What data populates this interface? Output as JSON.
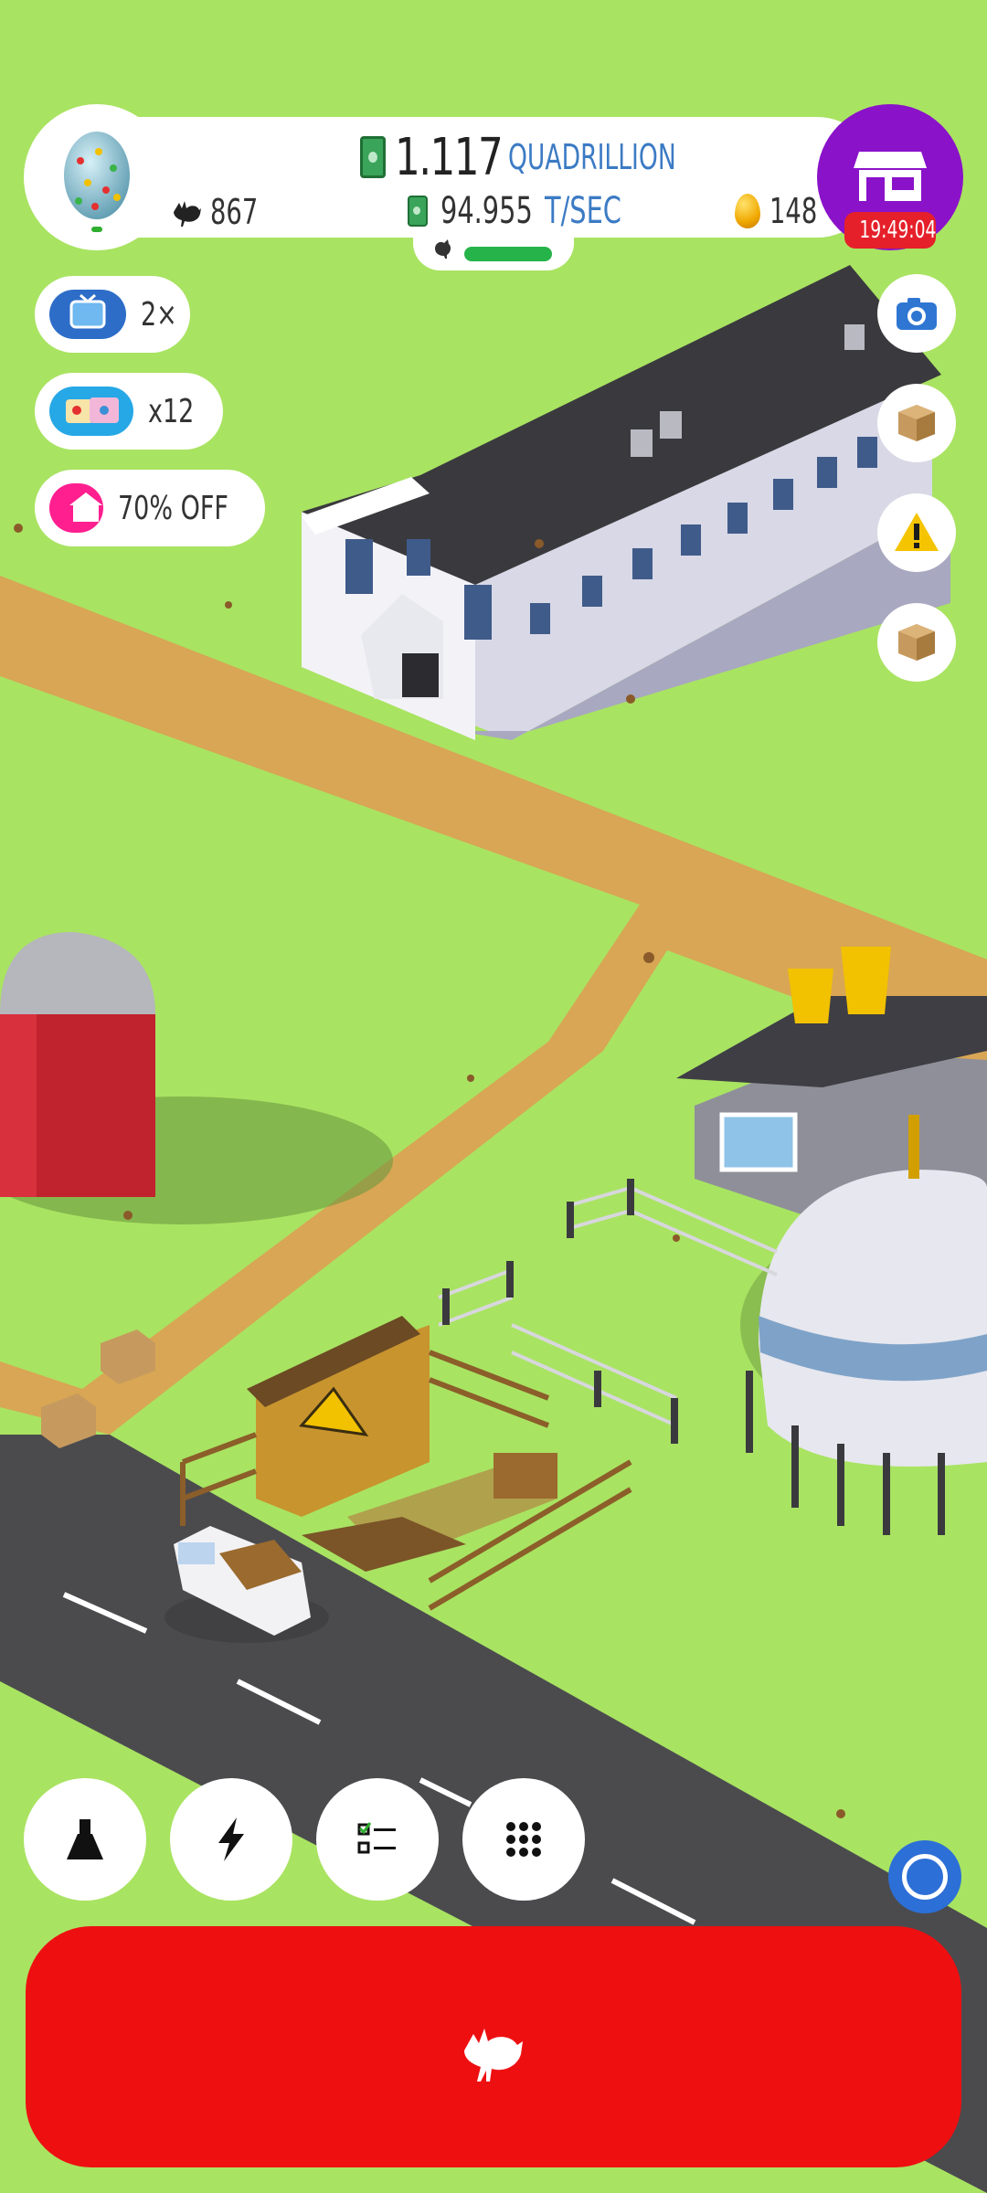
{
  "hud": {
    "cash_value": "1.117",
    "cash_unit": "QUADRILLION",
    "rate_value": "94.955",
    "rate_unit": "T/SEC",
    "chicken_count": "867",
    "golden_eggs": "148",
    "shop_timer": "19:49:04"
  },
  "left_buttons": {
    "video_multiplier": "2×",
    "boost_count": "x12",
    "sale_label": "70% OFF"
  },
  "icons": {
    "egg_badge": "christmas-egg-icon",
    "cash": "cash-bill-icon",
    "chicken": "chicken-icon",
    "golden_egg": "golden-egg-icon",
    "shop": "shop-icon",
    "camera": "camera-icon",
    "crate": "crate-icon",
    "warning": "warning-icon",
    "research": "flask-icon",
    "boosts": "lightning-icon",
    "missions": "checklist-icon",
    "menu": "grid-icon",
    "hatch": "chicken-icon"
  },
  "colors": {
    "grass": "#a9e362",
    "road": "#d8a654",
    "asphalt": "#4a4a4c",
    "shop": "#8a12c9",
    "hatch_button": "#ee0f11",
    "accent_blue": "#3c7bc4"
  }
}
